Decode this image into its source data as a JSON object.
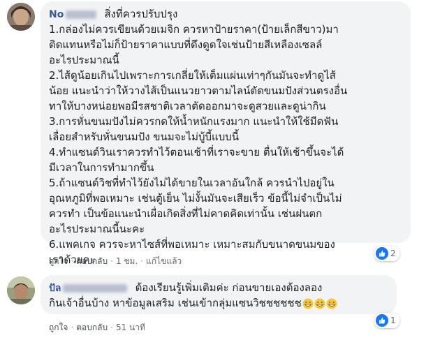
{
  "comments": [
    {
      "author": "No",
      "text_lines": [
        "สิ่งที่ควรปรับปรุง",
        "1.กล่องไม่ควรเขียนด้วยเมจิก ควรหาป้ายราคา(ป้ายเล็กสีขาว)มา",
        "ติดแทนหรือไม่ก็ป้ายราคาแบบที่ดึงดูดใจเช่นป้ายสีเหลืองเซลล์",
        "อะไรประมาณนี้",
        "2.ไส้ดูน้อยเกินไปเพราะการเกลี่ยให้เต็มแผ่นเท่าๆกันมันจะทำดูไส้",
        "น้อย แนะนำว่าให้วางไส้เป็นแนวยาวตามไลน์ตัดขนมปังส่วนตรงอื่น",
        "ทาให้บางหน่อยพอมีรสชาติเวลาตัดออกมาจะดูสวยและดูน่ากิน",
        "3.การหั่นขนมปังไม่ควรกดให้น้ำหนักแรงมาก แนะนำให้ใช้มีดฟัน",
        "เลื่อยสำหรับหั่นขนมปัง ขนมจะไม่บู้บี้แบบนี้",
        "4.ทำแซนด์วินเราควรทำไว้ตอนเช้าที่เราจะขาย ตื่นให้เช้าขึ้นจะได้",
        "มีเวลาในการทำมากขึ้น",
        "5.ถ้าแซนด์วิชที่ทำไว้ยังไม่ได้ขายในเวลาอันใกล้ ควรนำไปอยู่ใน",
        "อุณหภูมิที่พอเหมาะ เช่นตู้เย็น ไม่งั้นมันจะเสียเร็ว ข้อนี้ไม่จำเป็นไม่",
        "ควรทำ เป็นข้อแนะนำเผื่อเกิดสิ่งที่ไม่คาดคิดเท่านั้น เช่นฝนตก",
        "อะไรประมาณนี้นะคะ",
        "6.แพคเกจ ควรจะหาไซส์ที่พอเหมาะ เหมาะสมกับขนาดขนมของ",
        "เราด้วยคะ"
      ],
      "reaction_count": "2",
      "actions": {
        "like": "ถูกใจ",
        "reply": "ตอบกลับ",
        "time": "1 ชม.",
        "edited": "แก้ไขแล้ว"
      }
    },
    {
      "author": "ปัล",
      "text_line1": "ต้องเรียนรู้เพิ่มเติมค่ะ ก่อนขายเองต้องลอง",
      "text_line2": "กินเจ้าอื่นบ้าง หาข้อมูลเสริม เช่นเข้ากลุ่มแซนวิชชชชชช",
      "reaction_count": "1",
      "actions": {
        "like": "ถูกใจ",
        "reply": "ตอบกลับ",
        "time": "51 นาที"
      }
    }
  ],
  "colors": {
    "author": "#385898",
    "bubble": "#f2f3f5",
    "like_blue": "#1877f2"
  },
  "icons": [
    "like-icon",
    "grinning-emoji-icon"
  ]
}
